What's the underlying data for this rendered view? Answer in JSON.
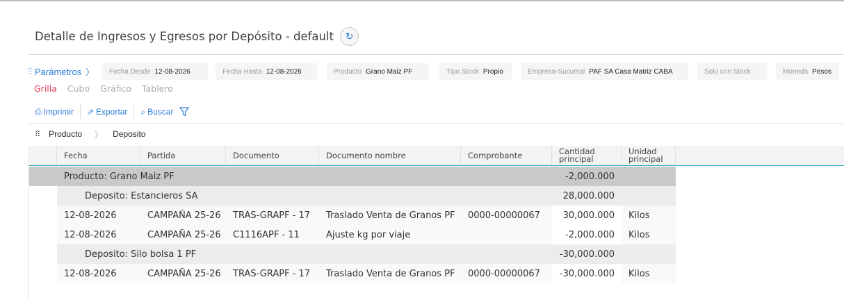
{
  "page": {
    "title": "Detalle de Ingresos y Egresos por Depósito - default"
  },
  "params": {
    "link_label": "Parámetros",
    "items": [
      {
        "label": "Fecha Desde",
        "value": "12-08-2026"
      },
      {
        "label": "Fecha Hasta",
        "value": "12-08-2026"
      },
      {
        "label": "Producto",
        "value": "Grano Maiz PF"
      },
      {
        "label": "Tipo Stock",
        "value": "Propio"
      },
      {
        "label": "Empresa-Sucursal",
        "value": "PAF SA Casa Matriz CABA"
      },
      {
        "label": "Solo con Stock",
        "value": ""
      },
      {
        "label": "Moneda",
        "value": "Pesos"
      }
    ]
  },
  "view_tabs": [
    "Grilla",
    "Cubo",
    "Gráfico",
    "Tablero"
  ],
  "toolbar": {
    "print": "Imprimir",
    "export": "Exportar",
    "search": "Buscar"
  },
  "grouping": [
    "Producto",
    "Deposito"
  ],
  "columns": [
    "Fecha",
    "Partida",
    "Documento",
    "Documento nombre",
    "Comprobante",
    "Cantidad\nprincipal",
    "Unidad\nprincipal"
  ],
  "rows": [
    {
      "type": "group1",
      "label": "Producto: Grano Maiz PF",
      "cantidad": "-2,000.000"
    },
    {
      "type": "group2",
      "label": "Deposito: Estancieros SA",
      "cantidad": "28,000.000"
    },
    {
      "type": "data",
      "fecha": "12-08-2026",
      "partida": "CAMPAÑA 25-26",
      "documento": "TRAS-GRAPF - 17",
      "doc_nombre": "Traslado Venta de Granos PF",
      "comprobante": "0000-00000067",
      "cantidad": "30,000.000",
      "unidad": "Kilos"
    },
    {
      "type": "data",
      "fecha": "12-08-2026",
      "partida": "CAMPAÑA 25-26",
      "documento": "C1116APF - 11",
      "doc_nombre": "Ajuste kg por viaje",
      "comprobante": "",
      "cantidad": "-2,000.000",
      "unidad": "Kilos"
    },
    {
      "type": "group2",
      "label": "Deposito: Silo bolsa 1 PF",
      "cantidad": "-30,000.000"
    },
    {
      "type": "data",
      "fecha": "12-08-2026",
      "partida": "CAMPAÑA 25-26",
      "documento": "TRAS-GRAPF - 17",
      "doc_nombre": "Traslado Venta de Granos PF",
      "comprobante": "0000-00000067",
      "cantidad": "-30,000.000",
      "unidad": "Kilos"
    }
  ],
  "colors": {
    "accent": "#2b7bd6",
    "active_tab": "#e5395a",
    "header_line": "#26a6b7"
  }
}
